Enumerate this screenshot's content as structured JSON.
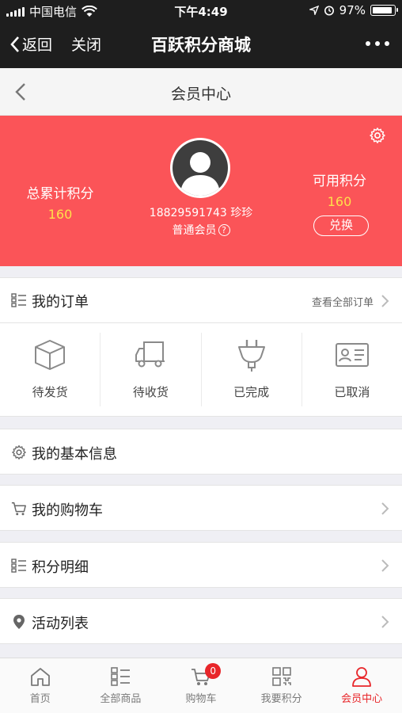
{
  "status_bar": {
    "carrier": "中国电信",
    "time": "下午4:49",
    "battery": "97%"
  },
  "wechat_nav": {
    "back_label": "返回",
    "close_label": "关闭",
    "title": "百跃积分商城"
  },
  "page_header": {
    "title": "会员中心"
  },
  "profile": {
    "total_points_label": "总累计积分",
    "total_points_value": "160",
    "available_points_label": "可用积分",
    "available_points_value": "160",
    "exchange_label": "兑换",
    "user_name": "18829591743 珍珍",
    "member_level": "普通会员",
    "help_mark": "?"
  },
  "orders": {
    "title": "我的订单",
    "view_all": "查看全部订单",
    "statuses": [
      {
        "label": "待发货",
        "icon": "box-icon"
      },
      {
        "label": "待收货",
        "icon": "truck-icon"
      },
      {
        "label": "已完成",
        "icon": "plug-icon"
      },
      {
        "label": "已取消",
        "icon": "card-icon"
      }
    ]
  },
  "menu": {
    "basic_info": "我的基本信息",
    "cart": "我的购物车",
    "points_detail": "积分明细",
    "activities": "活动列表"
  },
  "tabbar": {
    "tabs": [
      {
        "label": "首页",
        "icon": "home-icon"
      },
      {
        "label": "全部商品",
        "icon": "list-icon"
      },
      {
        "label": "购物车",
        "icon": "cart-icon"
      },
      {
        "label": "我要积分",
        "icon": "qr-icon"
      },
      {
        "label": "会员中心",
        "icon": "user-icon"
      }
    ],
    "cart_badge": "0",
    "active_color": "#e8262a"
  },
  "colors": {
    "banner": "#fb5458",
    "points_value": "#ffe04a"
  }
}
